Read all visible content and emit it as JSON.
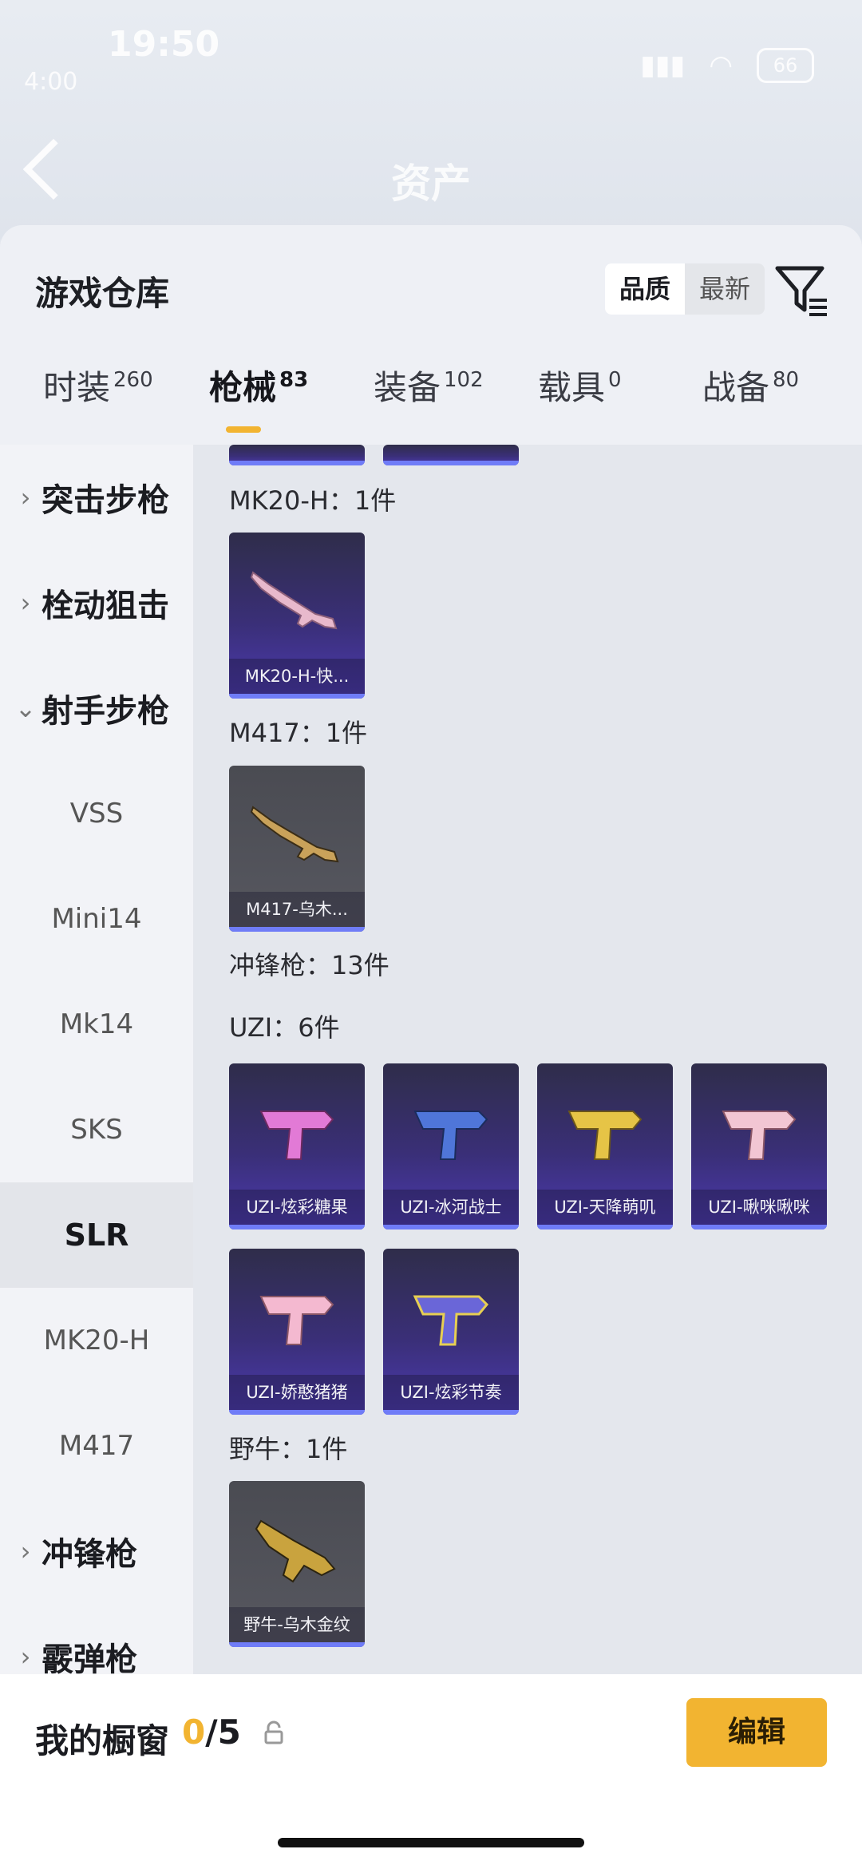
{
  "status": {
    "time": "19:50",
    "small": "4:00",
    "battery": "66"
  },
  "header": {
    "title": "资产"
  },
  "panel": {
    "title": "游戏仓库",
    "sort": {
      "quality": "品质",
      "newest": "最新"
    }
  },
  "tabs": [
    {
      "label": "时装",
      "count": "260"
    },
    {
      "label": "枪械",
      "count": "83"
    },
    {
      "label": "装备",
      "count": "102"
    },
    {
      "label": "载具",
      "count": "0"
    },
    {
      "label": "战备",
      "count": "80"
    }
  ],
  "sidebar": {
    "categories": [
      {
        "label": "突击步枪",
        "arrow": "›"
      },
      {
        "label": "栓动狙击",
        "arrow": "›"
      },
      {
        "label": "射手步枪",
        "arrow": "⌄"
      },
      {
        "label": "冲锋枪",
        "arrow": "›"
      },
      {
        "label": "霰弹枪",
        "arrow": "›"
      }
    ],
    "subcats": [
      "VSS",
      "Mini14",
      "Mk14",
      "SKS",
      "SLR",
      "MK20-H",
      "M417"
    ]
  },
  "content": {
    "sections": {
      "mk20": "MK20-H：1件",
      "m417": "M417：1件",
      "smg": "冲锋枪：13件",
      "uzi": "UZI：6件",
      "bison": "野牛：1件"
    },
    "items": {
      "mk20_1": "MK20-H-快...",
      "m417_1": "M417-乌木...",
      "uzi_1": "UZI-炫彩糖果",
      "uzi_2": "UZI-冰河战士",
      "uzi_3": "UZI-天降萌叽",
      "uzi_4": "UZI-啾咪啾咪",
      "uzi_5": "UZI-娇憨猪猪",
      "uzi_6": "UZI-炫彩节奏",
      "bison_1": "野牛-乌木金纹"
    }
  },
  "bottom": {
    "showcase_label": "我的橱窗",
    "current": "0",
    "total": "/5",
    "edit": "编辑"
  },
  "colors": {
    "accent": "#f2b431",
    "card_purple": "#3a2f78",
    "card_gray": "#4a4b52"
  }
}
